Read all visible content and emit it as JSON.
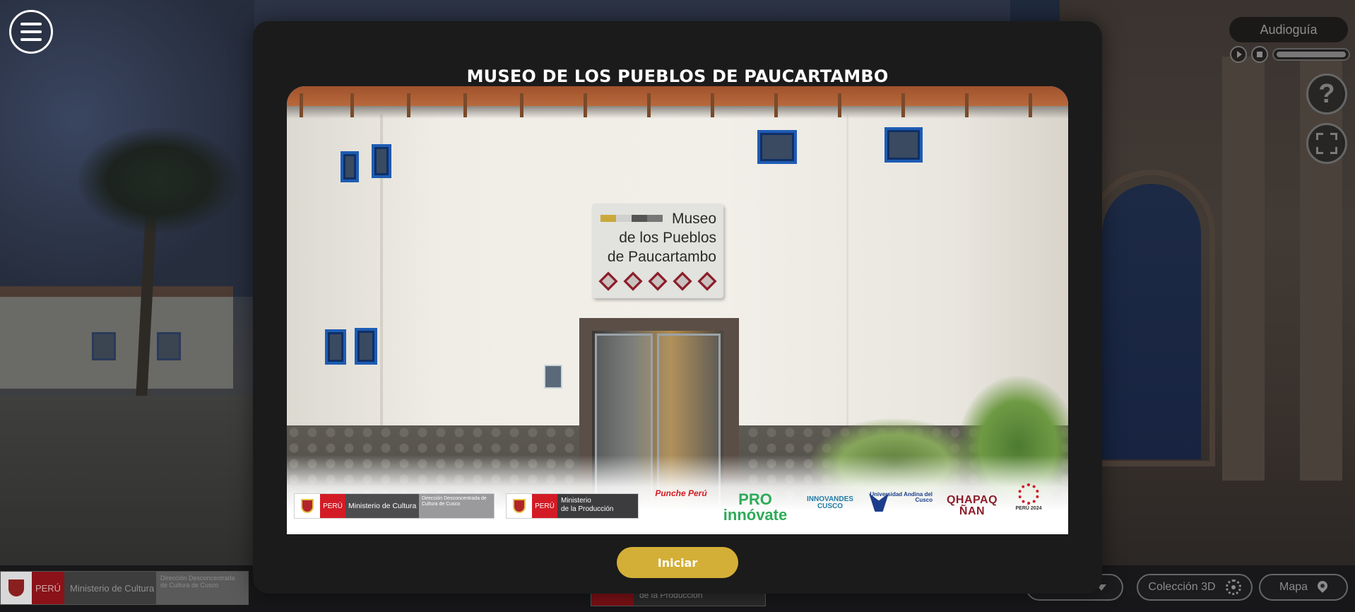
{
  "modal": {
    "title": "MUSEO DE LOS PUEBLOS DE PAUCARTAMBO",
    "start_button": "Iniciar",
    "image_sign": {
      "line1": "Museo",
      "line2": "de los Pueblos",
      "line3": "de Paucartambo"
    },
    "logos": {
      "ministerio_cultura": {
        "peru": "PERÚ",
        "ministerio": "Ministerio de Cultura",
        "direccion": "Dirección Desconcentrada de Cultura de Cusco"
      },
      "ministerio_produccion": {
        "peru": "PERÚ",
        "ministerio_line1": "Ministerio",
        "ministerio_line2": "de la Producción"
      },
      "punche": "Punche Perú",
      "proinnovate": "PRO innóvate",
      "innovandes": "INNOVANDES CUSCO",
      "universidad": "Universidad Andina del Cusco",
      "qhapaq": "QHAPAQ ÑAN",
      "bicentenario": "PERÚ 2024"
    }
  },
  "audio": {
    "label": "Audioguía",
    "progress": 0.0
  },
  "controls": {
    "help_symbol": "?"
  },
  "bottom_bar": {
    "peru": "PERÚ",
    "ministerio": "Ministerio de Cultura",
    "direccion": "Dirección Desconcentrada de Cultura de Cusco",
    "produccion": "de la Producción",
    "coleccion": "Colección 3D",
    "mapa": "Mapa"
  },
  "colors": {
    "accent": "#d4af37",
    "modal_bg": "#1b1b1b"
  },
  "icons": [
    "menu-icon",
    "play-icon",
    "stop-icon",
    "help-icon",
    "fullscreen-icon",
    "chevron-down-icon",
    "gear-icon",
    "map-pin-icon"
  ]
}
